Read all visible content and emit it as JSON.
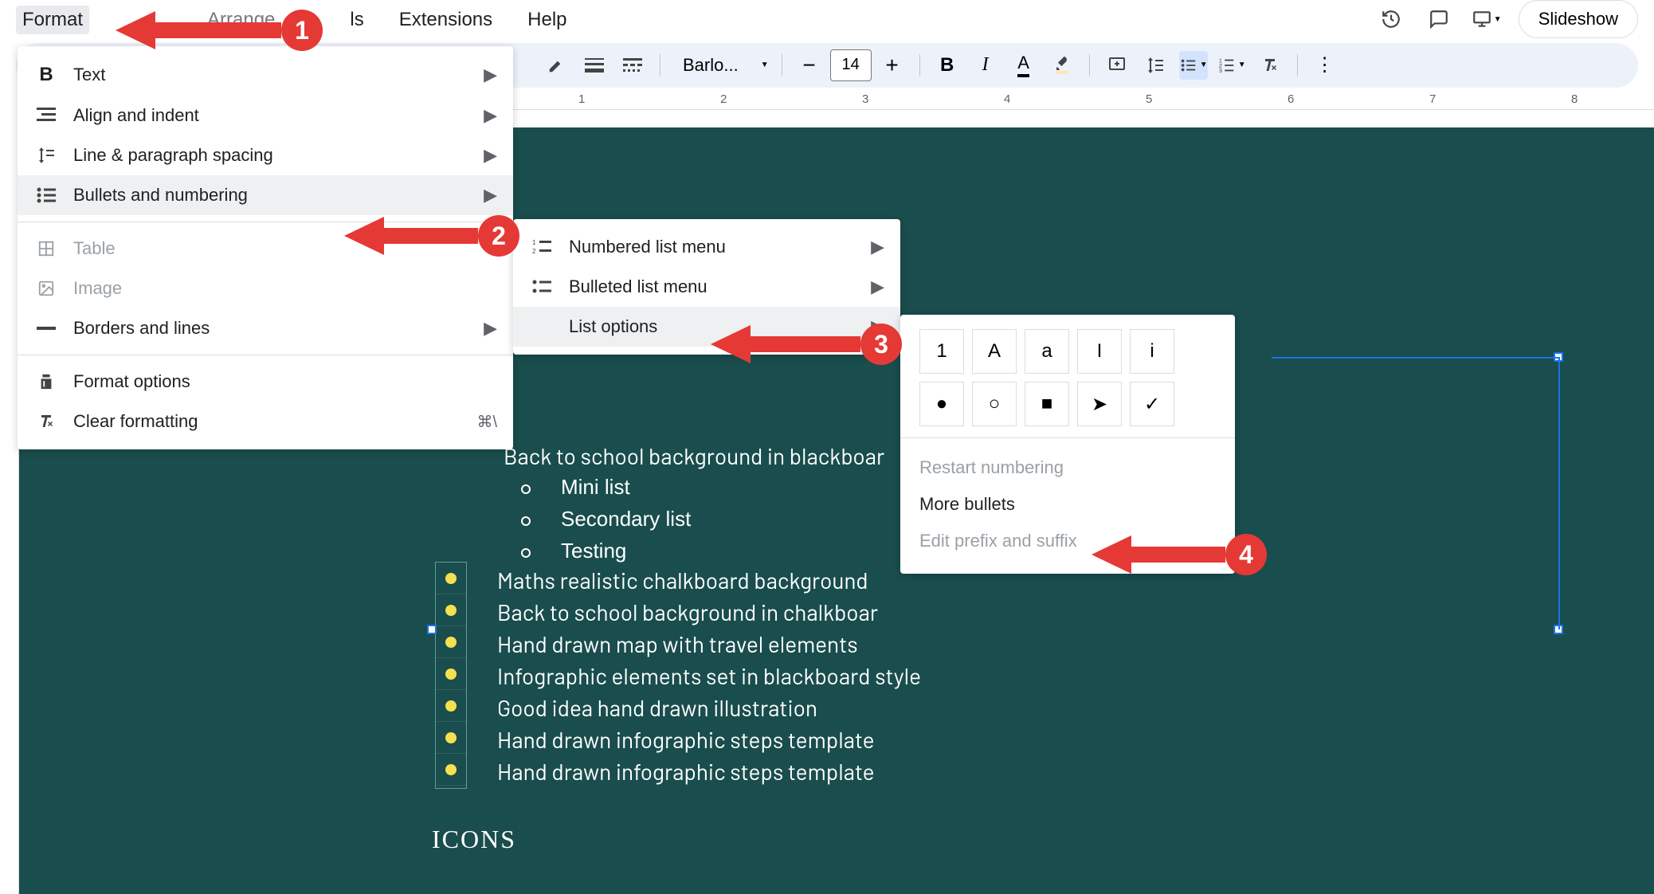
{
  "menubar": {
    "format": "Format",
    "arrange": "Arrange",
    "tools": "ls",
    "extensions": "Extensions",
    "help": "Help"
  },
  "top_right": {
    "slideshow": "Slideshow"
  },
  "toolbar": {
    "font_name": "Barlo...",
    "font_size": "14"
  },
  "ruler": {
    "marks": [
      "1",
      "2",
      "3",
      "4",
      "5",
      "6",
      "7",
      "8"
    ]
  },
  "format_menu": {
    "text": "Text",
    "align_indent": "Align and indent",
    "line_spacing": "Line & paragraph spacing",
    "bullets_numbering": "Bullets and numbering",
    "table": "Table",
    "image": "Image",
    "borders_lines": "Borders and lines",
    "format_options": "Format options",
    "clear_formatting": "Clear formatting",
    "clear_shortcut": "⌘\\"
  },
  "submenu1": {
    "numbered_list": "Numbered list menu",
    "bulleted_list": "Bulleted list menu",
    "list_options": "List options"
  },
  "submenu2": {
    "opts_row1": [
      "1",
      "A",
      "a",
      "I",
      "i"
    ],
    "opts_row2": [
      "●",
      "○",
      "■",
      "➤",
      "✓"
    ],
    "restart_numbering": "Restart numbering",
    "more_bullets": "More bullets",
    "edit_prefix": "Edit prefix and suffix"
  },
  "slide": {
    "line1": "Back to school background in blackboar",
    "sub1": "Mini list",
    "sub2": "Secondary list",
    "sub3": "Testing",
    "line2": "Maths realistic chalkboard background",
    "line3": "Back to school background in chalkboar",
    "line4": "Hand drawn map with travel elements",
    "line5": "Infographic elements set in blackboard style",
    "line6": "Good idea hand drawn illustration",
    "line7": "Hand drawn infographic steps template",
    "line8": "Hand drawn infographic steps template",
    "icons_label": "ICONS"
  },
  "badges": {
    "n1": "1",
    "n2": "2",
    "n3": "3",
    "n4": "4"
  }
}
